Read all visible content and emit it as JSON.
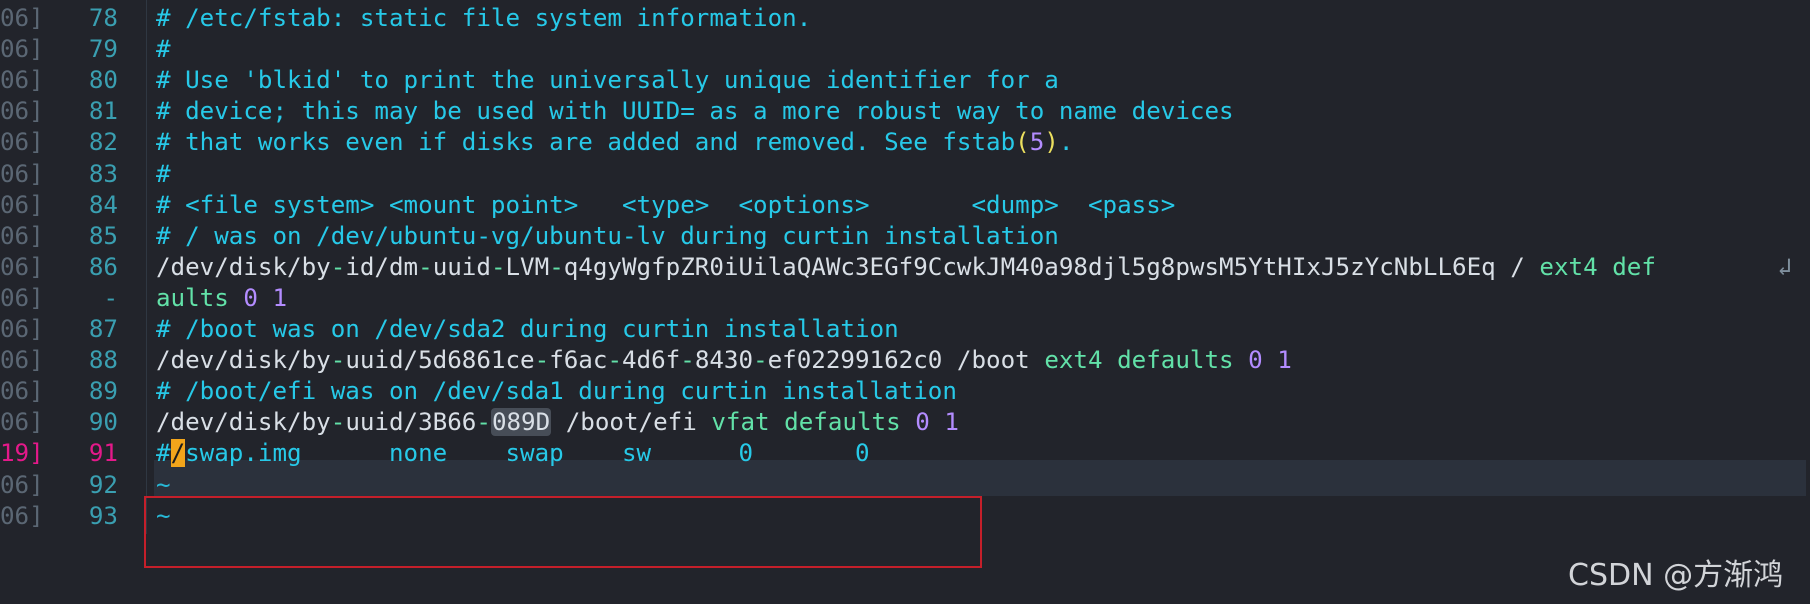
{
  "editor": {
    "lines": [
      {
        "left": "06]",
        "num": "78",
        "parts": [
          {
            "t": "# /etc/fstab: static file system information.",
            "c": "comment"
          }
        ]
      },
      {
        "left": "06]",
        "num": "79",
        "parts": [
          {
            "t": "#",
            "c": "comment"
          }
        ]
      },
      {
        "left": "06]",
        "num": "80",
        "parts": [
          {
            "t": "# Use 'blkid' to print the universally unique identifier for a",
            "c": "comment"
          }
        ]
      },
      {
        "left": "06]",
        "num": "81",
        "parts": [
          {
            "t": "# device; this may be used with UUID= as a more robust way to name devices",
            "c": "comment"
          }
        ]
      },
      {
        "left": "06]",
        "num": "82",
        "parts": [
          {
            "t": "# that works even if disks are added and removed. See fstab",
            "c": "comment"
          },
          {
            "t": "(",
            "c": "yellow"
          },
          {
            "t": "5",
            "c": "purple"
          },
          {
            "t": ")",
            "c": "yellow"
          },
          {
            "t": ".",
            "c": "comment"
          }
        ]
      },
      {
        "left": "06]",
        "num": "83",
        "parts": [
          {
            "t": "#",
            "c": "comment"
          }
        ]
      },
      {
        "left": "06]",
        "num": "84",
        "parts": [
          {
            "t": "# <file system> <mount point>   <type>  <options>       <dump>  <pass>",
            "c": "comment"
          }
        ]
      },
      {
        "left": "06]",
        "num": "85",
        "parts": [
          {
            "t": "# / was on /dev/ubuntu-vg/ubuntu-lv during curtin installation",
            "c": "comment"
          }
        ]
      },
      {
        "left": "06]",
        "num": "86",
        "parts": [
          {
            "t": "/dev/disk/by",
            "c": "plain"
          },
          {
            "t": "-",
            "c": "green"
          },
          {
            "t": "id/dm",
            "c": "plain"
          },
          {
            "t": "-",
            "c": "green"
          },
          {
            "t": "uuid",
            "c": "plain"
          },
          {
            "t": "-",
            "c": "green"
          },
          {
            "t": "LVM",
            "c": "plain"
          },
          {
            "t": "-",
            "c": "green"
          },
          {
            "t": "q4gyWgfpZR0iUilaQAWc3EGf9CcwkJM40a98djl5g8pwsM5YtHIxJ5zYcNbLL6Eq / ",
            "c": "plain"
          },
          {
            "t": "ext4 def",
            "c": "green"
          }
        ],
        "wrap": "↲"
      },
      {
        "left": "06]",
        "num": "-",
        "parts": [
          {
            "t": "aults",
            "c": "green"
          },
          {
            "t": " 0 1",
            "c": "purple"
          }
        ]
      },
      {
        "left": "06]",
        "num": "87",
        "parts": [
          {
            "t": "# /boot was on /dev/sda2 during curtin installation",
            "c": "comment"
          }
        ]
      },
      {
        "left": "06]",
        "num": "88",
        "parts": [
          {
            "t": "/dev/disk/by",
            "c": "plain"
          },
          {
            "t": "-",
            "c": "green"
          },
          {
            "t": "uuid/5d6861ce",
            "c": "plain"
          },
          {
            "t": "-",
            "c": "green"
          },
          {
            "t": "f6ac",
            "c": "plain"
          },
          {
            "t": "-",
            "c": "green"
          },
          {
            "t": "4d6f",
            "c": "plain"
          },
          {
            "t": "-",
            "c": "green"
          },
          {
            "t": "8430",
            "c": "plain"
          },
          {
            "t": "-",
            "c": "green"
          },
          {
            "t": "ef02299162c0 /boot ",
            "c": "plain"
          },
          {
            "t": "ext4 defaults",
            "c": "green"
          },
          {
            "t": " 0 1",
            "c": "purple"
          }
        ]
      },
      {
        "left": "06]",
        "num": "89",
        "parts": [
          {
            "t": "# /boot/efi was on /dev/sda1 during curtin installation",
            "c": "comment"
          }
        ]
      },
      {
        "left": "06]",
        "num": "90",
        "parts": [
          {
            "t": "/dev/disk/by",
            "c": "plain"
          },
          {
            "t": "-",
            "c": "green"
          },
          {
            "t": "uuid/3B66",
            "c": "plain"
          },
          {
            "t": "-",
            "c": "green"
          },
          {
            "t": "089D",
            "c": "plain hl"
          },
          {
            "t": " /boot/efi ",
            "c": "plain"
          },
          {
            "t": "vfat defaults",
            "c": "green"
          },
          {
            "t": " 0 1",
            "c": "purple"
          }
        ]
      },
      {
        "left": "19]",
        "num": "91",
        "hot": true,
        "parts": [
          {
            "t": "#",
            "c": "comment"
          },
          {
            "t": "/",
            "c": "cursor"
          },
          {
            "t": "swap.img      none    swap    sw      0       0",
            "c": "comment"
          }
        ]
      },
      {
        "left": "06]",
        "num": "92",
        "parts": [
          {
            "t": "~",
            "c": "tilde"
          }
        ]
      },
      {
        "left": "06]",
        "num": "93",
        "parts": [
          {
            "t": "~",
            "c": "tilde"
          }
        ]
      }
    ]
  },
  "watermark": "CSDN @方渐鸿"
}
